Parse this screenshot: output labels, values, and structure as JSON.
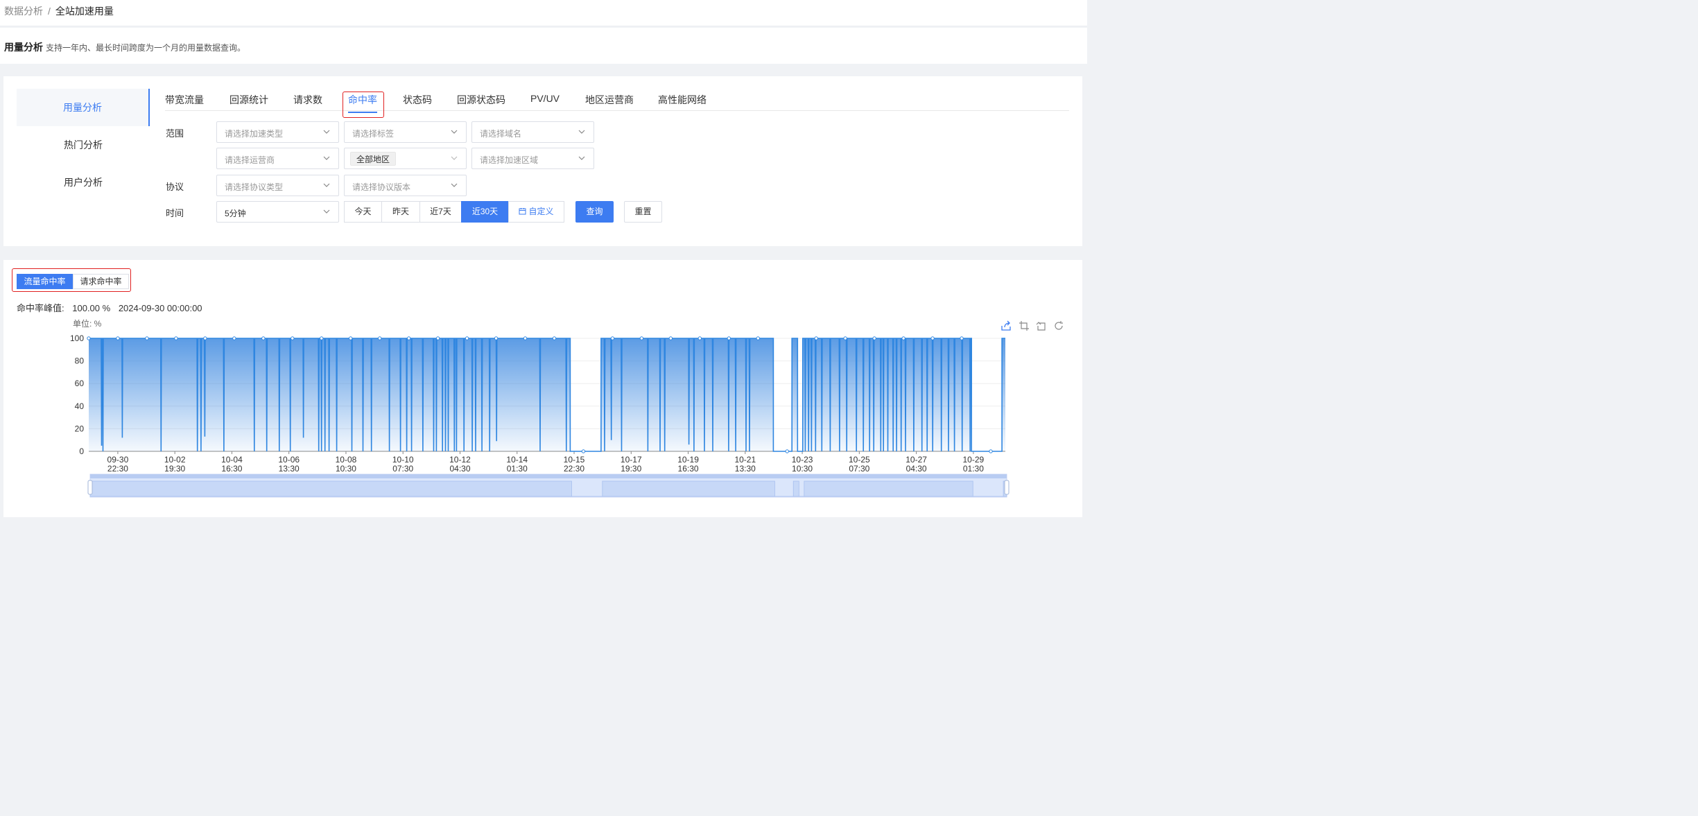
{
  "breadcrumb": {
    "parent": "数据分析",
    "separator": "/",
    "current": "全站加速用量"
  },
  "intro": {
    "title": "用量分析",
    "description": "支持一年内、最长时间跨度为一个月的用量数据查询。"
  },
  "left_nav": {
    "items": [
      {
        "label": "用量分析",
        "active": true
      },
      {
        "label": "热门分析"
      },
      {
        "label": "用户分析"
      }
    ]
  },
  "tabs": [
    {
      "label": "带宽流量"
    },
    {
      "label": "回源统计"
    },
    {
      "label": "请求数"
    },
    {
      "label": "命中率",
      "active": true
    },
    {
      "label": "状态码"
    },
    {
      "label": "回源状态码"
    },
    {
      "label": "PV/UV"
    },
    {
      "label": "地区运营商"
    },
    {
      "label": "高性能网络"
    }
  ],
  "filters": {
    "scope_label": "范围",
    "accel_type_placeholder": "请选择加速类型",
    "tag_placeholder": "请选择标签",
    "domain_placeholder": "请选择域名",
    "isp_placeholder": "请选择运营商",
    "region_tag": "全部地区",
    "accel_region_placeholder": "请选择加速区域",
    "protocol_label": "协议",
    "protocol_type_placeholder": "请选择协议类型",
    "protocol_version_placeholder": "请选择协议版本",
    "time_label": "时间",
    "granularity_value": "5分钟",
    "ranges": [
      {
        "label": "今天"
      },
      {
        "label": "昨天"
      },
      {
        "label": "近7天"
      },
      {
        "label": "近30天",
        "active": true
      }
    ],
    "custom_label": "自定义",
    "query_label": "查询",
    "reset_label": "重置"
  },
  "hit_toggle": {
    "options": [
      {
        "label": "流量命中率",
        "active": true
      },
      {
        "label": "请求命中率"
      }
    ]
  },
  "peak": {
    "label": "命中率峰值:",
    "value": "100.00 %",
    "time": "2024-09-30 00:00:00"
  },
  "colors": {
    "accent": "#3d7cf1",
    "series": "#2f86e0",
    "highlight_box": "#e02020"
  },
  "toolbar_icons": [
    "export-icon",
    "zoom-select-icon",
    "zoom-reset-icon",
    "restore-icon"
  ],
  "chart_data": {
    "type": "area",
    "unit_label": "单位: %",
    "ylim": [
      0,
      100
    ],
    "y_ticks": [
      0,
      20,
      40,
      60,
      80,
      100
    ],
    "x_ticks": [
      [
        "09-30",
        "22:30"
      ],
      [
        "10-02",
        "19:30"
      ],
      [
        "10-04",
        "16:30"
      ],
      [
        "10-06",
        "13:30"
      ],
      [
        "10-08",
        "10:30"
      ],
      [
        "10-10",
        "07:30"
      ],
      [
        "10-12",
        "04:30"
      ],
      [
        "10-14",
        "01:30"
      ],
      [
        "10-15",
        "22:30"
      ],
      [
        "10-17",
        "19:30"
      ],
      [
        "10-19",
        "16:30"
      ],
      [
        "10-21",
        "13:30"
      ],
      [
        "10-23",
        "10:30"
      ],
      [
        "10-25",
        "07:30"
      ],
      [
        "10-27",
        "04:30"
      ],
      [
        "10-29",
        "01:30"
      ]
    ],
    "segments": [
      {
        "from": 0.0,
        "to": 0.5253,
        "value": 100
      },
      {
        "from": 0.5253,
        "to": 0.5589,
        "value": 0
      },
      {
        "from": 0.5589,
        "to": 0.7469,
        "value": 100
      },
      {
        "from": 0.7469,
        "to": 0.7672,
        "value": 0
      },
      {
        "from": 0.7672,
        "to": 0.7733,
        "value": 100
      },
      {
        "from": 0.7733,
        "to": 0.779,
        "value": 0
      },
      {
        "from": 0.779,
        "to": 0.9631,
        "value": 100
      },
      {
        "from": 0.9631,
        "to": 0.9963,
        "value": 0
      },
      {
        "from": 0.9963,
        "to": 1.0,
        "value": 100
      }
    ],
    "dips": [
      [
        0.0136,
        5
      ],
      [
        0.0151,
        0
      ],
      [
        0.0362,
        12
      ],
      [
        0.0785,
        0
      ],
      [
        0.1181,
        0
      ],
      [
        0.1221,
        0
      ],
      [
        0.1262,
        13
      ],
      [
        0.147,
        0
      ],
      [
        0.1802,
        0
      ],
      [
        0.1938,
        0
      ],
      [
        0.2075,
        0
      ],
      [
        0.2195,
        0
      ],
      [
        0.2338,
        12
      ],
      [
        0.2505,
        0
      ],
      [
        0.2535,
        0
      ],
      [
        0.2573,
        0
      ],
      [
        0.2618,
        0
      ],
      [
        0.2701,
        0
      ],
      [
        0.2867,
        0
      ],
      [
        0.2988,
        0
      ],
      [
        0.308,
        0
      ],
      [
        0.3276,
        0
      ],
      [
        0.3397,
        0
      ],
      [
        0.3465,
        0
      ],
      [
        0.3518,
        0
      ],
      [
        0.3641,
        0
      ],
      [
        0.3759,
        0
      ],
      [
        0.3789,
        0
      ],
      [
        0.3855,
        0
      ],
      [
        0.3888,
        0
      ],
      [
        0.3918,
        0
      ],
      [
        0.3985,
        0
      ],
      [
        0.4008,
        0
      ],
      [
        0.409,
        0
      ],
      [
        0.418,
        0
      ],
      [
        0.4217,
        0
      ],
      [
        0.4286,
        0
      ],
      [
        0.437,
        0
      ],
      [
        0.4445,
        9
      ],
      [
        0.492,
        0
      ],
      [
        0.5206,
        0
      ],
      [
        0.5624,
        0
      ],
      [
        0.5697,
        10
      ],
      [
        0.5809,
        0
      ],
      [
        0.6096,
        0
      ],
      [
        0.6229,
        0
      ],
      [
        0.628,
        0
      ],
      [
        0.6544,
        6
      ],
      [
        0.6599,
        0
      ],
      [
        0.6713,
        0
      ],
      [
        0.6804,
        0
      ],
      [
        0.6977,
        0
      ],
      [
        0.7054,
        0
      ],
      [
        0.7167,
        0
      ],
      [
        0.7205,
        0
      ],
      [
        0.7813,
        0
      ],
      [
        0.7849,
        0
      ],
      [
        0.7881,
        0
      ],
      [
        0.7926,
        0
      ],
      [
        0.7994,
        0
      ],
      [
        0.8085,
        0
      ],
      [
        0.8187,
        0
      ],
      [
        0.8265,
        0
      ],
      [
        0.8371,
        0
      ],
      [
        0.8447,
        0
      ],
      [
        0.8515,
        0
      ],
      [
        0.856,
        0
      ],
      [
        0.8637,
        0
      ],
      [
        0.8666,
        0
      ],
      [
        0.8714,
        0
      ],
      [
        0.8772,
        0
      ],
      [
        0.8809,
        0
      ],
      [
        0.8859,
        0
      ],
      [
        0.8907,
        0
      ],
      [
        0.8997,
        0
      ],
      [
        0.9086,
        0
      ],
      [
        0.9143,
        0
      ],
      [
        0.9203,
        0
      ],
      [
        0.9298,
        0
      ],
      [
        0.9376,
        0
      ],
      [
        0.9441,
        0
      ],
      [
        0.9525,
        0
      ],
      [
        0.9612,
        0
      ]
    ]
  }
}
